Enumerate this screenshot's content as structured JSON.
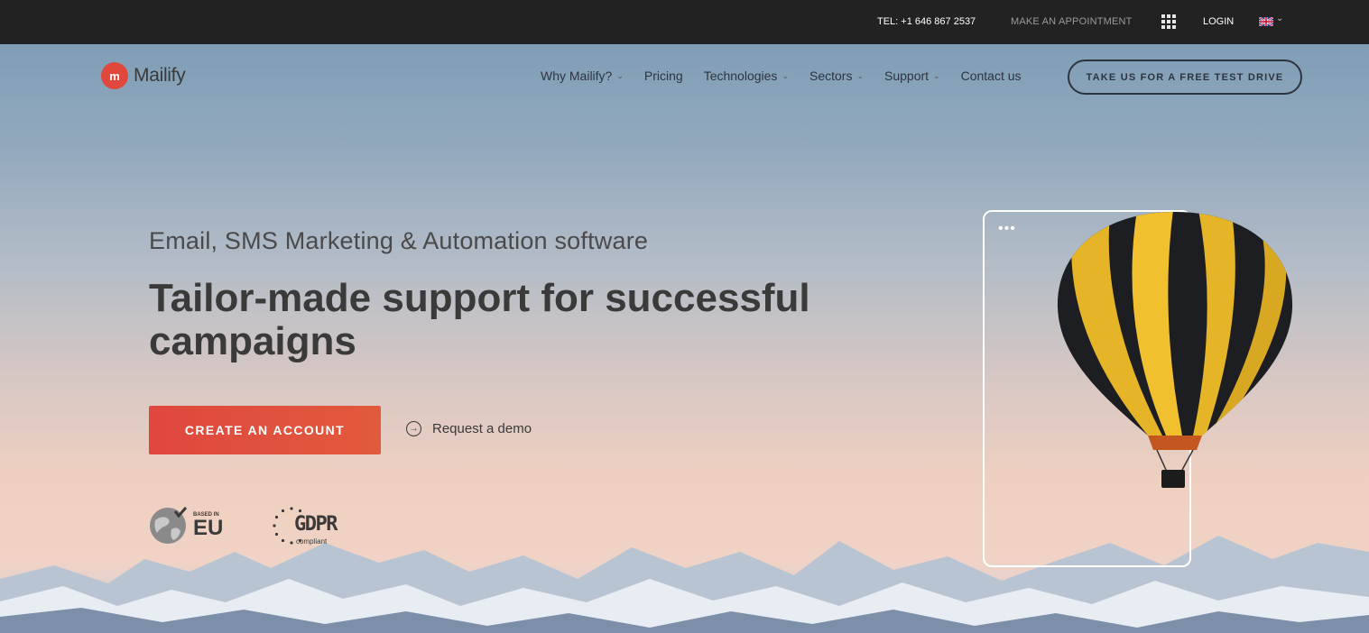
{
  "topbar": {
    "tel": "TEL: +1 646 867 2537",
    "appointment": "MAKE AN APPOINTMENT",
    "login": "LOGIN",
    "language_icon": "uk-flag-icon"
  },
  "brand": {
    "name": "Mailify",
    "logo_glyph": "m"
  },
  "nav": {
    "items": [
      {
        "label": "Why Mailify?",
        "has_dropdown": true
      },
      {
        "label": "Pricing",
        "has_dropdown": false
      },
      {
        "label": "Technologies",
        "has_dropdown": true
      },
      {
        "label": "Sectors",
        "has_dropdown": true
      },
      {
        "label": "Support",
        "has_dropdown": true
      },
      {
        "label": "Contact us",
        "has_dropdown": false
      }
    ],
    "cta": "TAKE US FOR A FREE TEST DRIVE"
  },
  "hero": {
    "subtitle": "Email, SMS Marketing & Automation software",
    "headline": "Tailor-made support for successful campaigns",
    "primary_button": "CREATE AN ACCOUNT",
    "secondary_link": "Request a demo"
  },
  "badges": {
    "eu_small": "BASED IN",
    "eu_big": "EU",
    "gdpr_big": "GDPR",
    "gdpr_small": "compliant"
  },
  "colors": {
    "accent": "#e0483d",
    "topbar": "#222222",
    "text_dark": "#3a3a3a"
  }
}
